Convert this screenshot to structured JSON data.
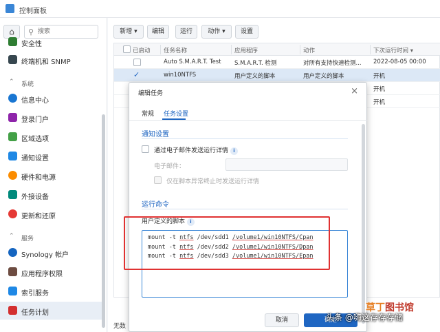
{
  "window": {
    "title": "控制面板"
  },
  "search": {
    "placeholder": "搜索"
  },
  "sidebar": {
    "items": [
      {
        "label": "安全性",
        "color": "#2e7d32"
      },
      {
        "label": "终端机和 SNMP",
        "color": "#37474f"
      }
    ],
    "section_system": "系统",
    "system_items": [
      {
        "label": "信息中心",
        "color": "#1976d2"
      },
      {
        "label": "登录门户",
        "color": "#8e24aa"
      },
      {
        "label": "区域选项",
        "color": "#43a047"
      },
      {
        "label": "通知设置",
        "color": "#1e88e5"
      },
      {
        "label": "硬件和电源",
        "color": "#fb8c00"
      },
      {
        "label": "外接设备",
        "color": "#00897b"
      },
      {
        "label": "更新和还原",
        "color": "#e53935"
      }
    ],
    "section_services": "服务",
    "service_items": [
      {
        "label": "Synology 帐户",
        "color": "#1565c0"
      },
      {
        "label": "应用程序权限",
        "color": "#6d4c41"
      },
      {
        "label": "索引服务",
        "color": "#1e88e5"
      },
      {
        "label": "任务计划",
        "color": "#d32f2f"
      }
    ]
  },
  "toolbar": {
    "create": "新增 ▾",
    "edit": "编辑",
    "run": "运行",
    "action": "动作 ▾",
    "settings": "设置"
  },
  "table": {
    "headers": [
      "已启动",
      "任务名称",
      "应用程序",
      "动作",
      "下次运行时间 ▾"
    ],
    "rows": [
      {
        "enabled": false,
        "name": "Auto S.M.A.R.T. Test",
        "app": "S.M.A.R.T. 检测",
        "action": "对所有支持快速检测...",
        "next": "2022-08-05 00:00"
      },
      {
        "enabled": true,
        "name": "win10NTFS",
        "app": "用户定义的脚本",
        "action": "用户定义的脚本",
        "next": "开机"
      },
      {
        "enabled": false,
        "name": "",
        "app": "",
        "action": "",
        "next": "开机"
      },
      {
        "enabled": false,
        "name": "",
        "app": "",
        "action": "",
        "next": "开机"
      }
    ]
  },
  "status": {
    "text": "无数"
  },
  "dialog": {
    "title": "编辑任务",
    "tabs": [
      "常规",
      "任务设置"
    ],
    "notify_title": "通知设置",
    "email_checkbox": "通过电子邮件发送运行详情",
    "email_label": "电子邮件：",
    "only_abnormal": "仅在脚本异常终止时发送运行详情",
    "run_title": "运行命令",
    "script_label": "用户定义的脚本",
    "script_lines": [
      {
        "pre": "mount -t ",
        "fs": "ntfs",
        "mid": " /dev/sdd1 ",
        "path": "/volume1/win10NTFS/Cpan"
      },
      {
        "pre": "mount -t ",
        "fs": "ntfs",
        "mid": " /dev/sdd2 ",
        "path": "/volume1/win10NTFS/Dpan"
      },
      {
        "pre": "mount -t ",
        "fs": "ntfs",
        "mid": " /dev/sdd3 ",
        "path": "/volume1/win10NTFS/Epan"
      }
    ],
    "cancel": "取消",
    "ok": "确定"
  },
  "watermark": {
    "left": "头条 @嗨这存存存储",
    "right_a": "草丁",
    "right_b": "图书馆"
  }
}
